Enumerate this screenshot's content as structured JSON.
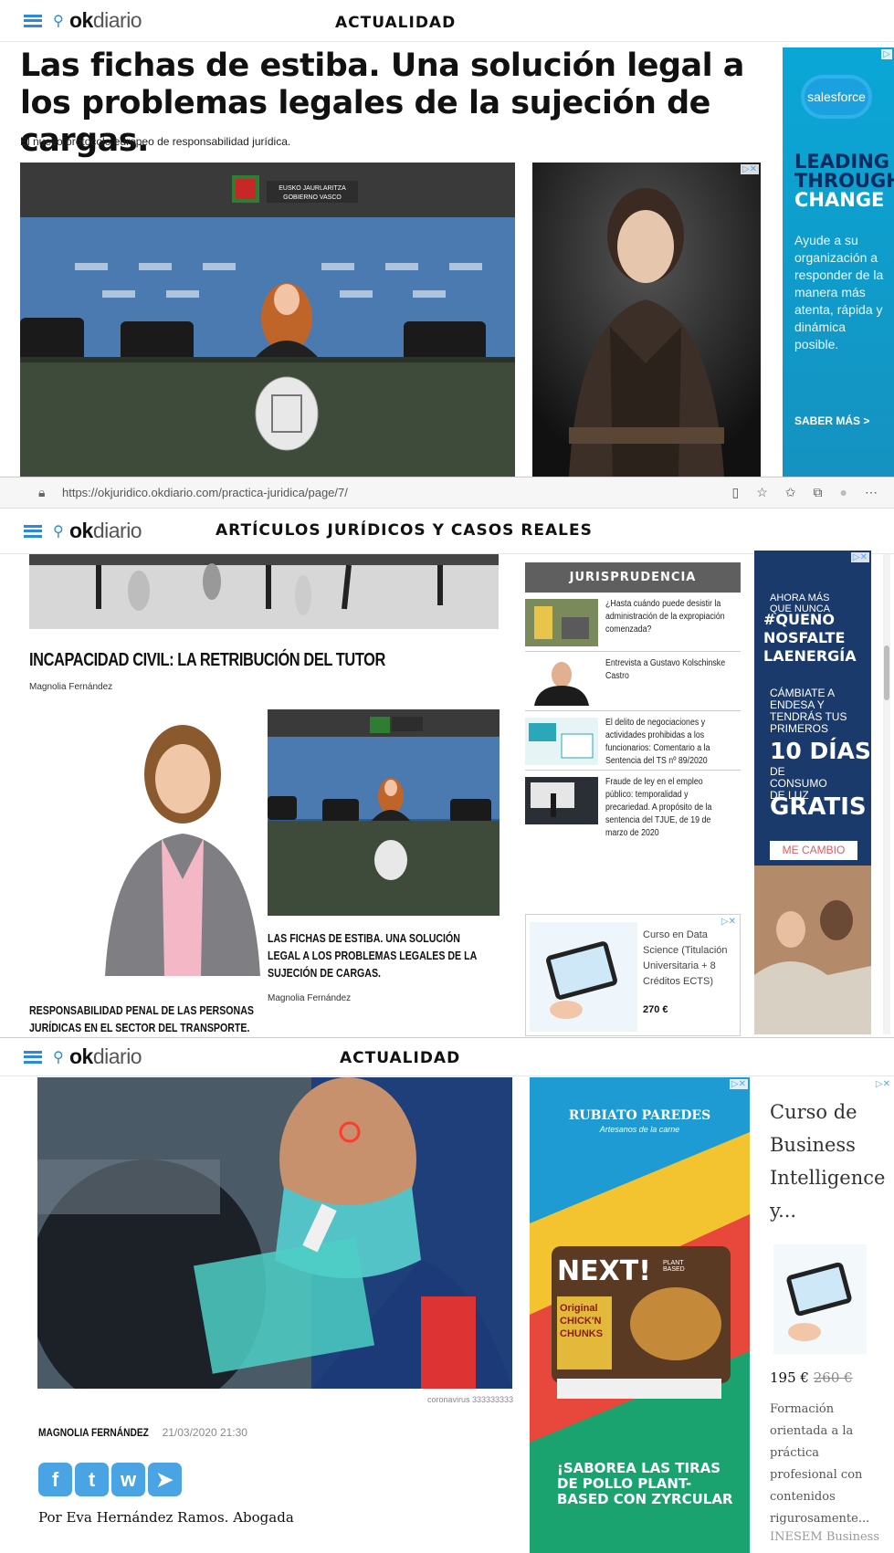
{
  "panel1": {
    "logo": {
      "ok": "ok",
      "diario": "diario"
    },
    "section": "ACTUALIDAD",
    "headline": "Las fichas de estiba. Una solución legal a los problemas legales de la sujeción de cargas.",
    "subtitle": "El nuevo protocolo europeo de responsabilidad jurídica.",
    "photo_sign": "EUSKO JAURLARITZA GOBIERNO VASCO",
    "salesforce_ad": {
      "brand": "salesforce",
      "head_lines": [
        "LEADING",
        "THROUGH",
        "CHANGE"
      ],
      "body": "Ayude a su organización a responder de la manera más atenta, rápida y dinámica posible.",
      "cta": "SABER MÁS >"
    }
  },
  "browser": {
    "url": "https://okjuridico.okdiario.com/practica-juridica/page/7/",
    "icons": [
      "reader-icon",
      "star-icon",
      "favorites-icon",
      "collections-icon",
      "profile-icon",
      "more-icon"
    ],
    "icon_glyphs": [
      "▯",
      "☆",
      "✩",
      "⧉",
      "●",
      "⋯"
    ]
  },
  "panel2": {
    "logo": {
      "ok": "ok",
      "diario": "diario"
    },
    "section": "ARTÍCULOS JURÍDICOS Y CASOS REALES",
    "article_title": "INCAPACIDAD CIVIL: LA RETRIBUCIÓN DEL TUTOR",
    "article_author": "Magnolia Fernández",
    "card1_title": "RESPONSABILIDAD PENAL DE LAS PERSONAS JURÍDICAS EN EL SECTOR DEL TRANSPORTE.",
    "card2_title": "LAS FICHAS DE ESTIBA. UNA SOLUCIÓN LEGAL A LOS PROBLEMAS LEGALES DE LA SUJECIÓN DE CARGAS.",
    "card2_author": "Magnolia Fernández",
    "jurisprudencia": {
      "heading": "JURISPRUDENCIA",
      "items": [
        {
          "text": "¿Hasta cuándo puede desistir la administración de la expropiación comenzada?"
        },
        {
          "text": "Entrevista a Gustavo Kolschinske Castro"
        },
        {
          "text": "El delito de negociaciones y actividades prohibidas a los funcionarios: Comentario a la Sentencia del TS nº 89/2020"
        },
        {
          "text": "Fraude de ley en el empleo público: temporalidad y precariedad. A propósito de la sentencia del TJUE, de 19 de marzo de 2020"
        }
      ]
    },
    "endesa_ad": {
      "small": "AHORA MÁS QUE NUNCA",
      "big_lines": [
        "#QUENO",
        "NOSFALTE",
        "LAENERGÍA"
      ],
      "mid": "CÁMBIATE A ENDESA Y TENDRÁS TUS PRIMEROS",
      "dias": "10 DÍAS",
      "consumo": "DE CONSUMO DE LUZ",
      "gratis": "GRATIS",
      "cta": "ME CAMBIO"
    },
    "course_ad": {
      "text": "Curso en Data Science (Titulación Universitaria + 8 Créditos ECTS)",
      "price": "270 €"
    }
  },
  "panel3": {
    "logo": {
      "ok": "ok",
      "diario": "diario"
    },
    "section": "ACTUALIDAD",
    "caption": "coronavirus 333333333",
    "author": "MAGNOLIA FERNÁNDEZ",
    "date": "21/03/2020 21:30",
    "byline": "Por Eva Hernández Ramos. Abogada",
    "social": [
      "f",
      "t",
      "w",
      "➤"
    ],
    "rubiato_ad": {
      "brand": "RUBIATO PAREDES",
      "tagline": "Artesanos de la carne",
      "product": "NEXT!",
      "product_sub": "Original CHICK'N CHUNKS",
      "pack_label": "PLANT BASED",
      "slogan": "¡SABOREA LAS TIRAS DE POLLO PLANT-BASED CON ZYRCULAR"
    },
    "inesem_ad": {
      "title": "Curso de Business Intelligence y...",
      "price_new": "195 €",
      "price_old": "260 €",
      "description": "Formación orientada a la práctica profesional con contenidos rigurosamente...",
      "brand": "INESEM Business School"
    }
  }
}
